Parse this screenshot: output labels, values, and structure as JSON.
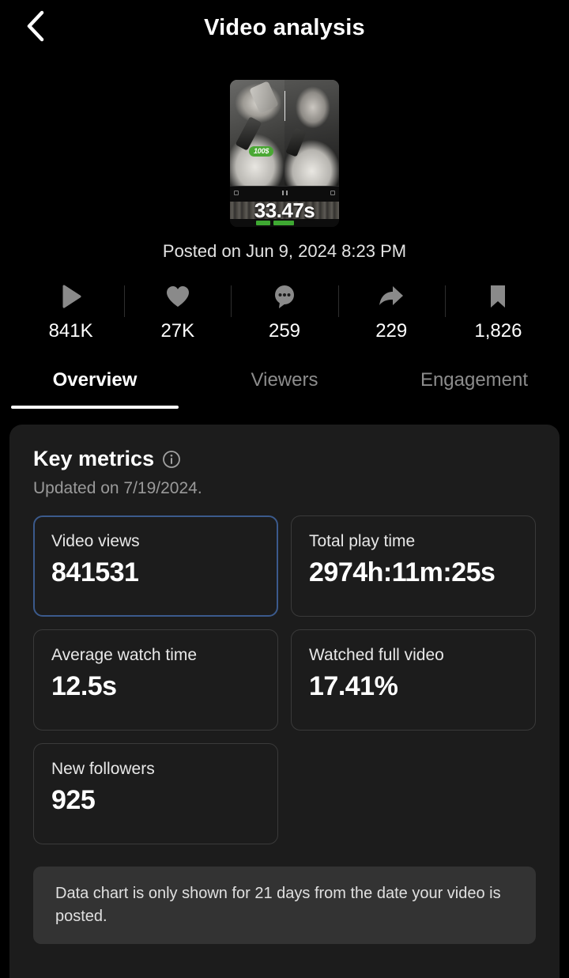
{
  "header": {
    "back_icon": "chevron-left-icon",
    "title": "Video analysis"
  },
  "video": {
    "duration": "33.47s",
    "badge": "100$",
    "posted": "Posted on Jun 9, 2024 8:23 PM"
  },
  "stats": [
    {
      "icon": "play-icon",
      "value": "841K"
    },
    {
      "icon": "heart-icon",
      "value": "27K"
    },
    {
      "icon": "comment-icon",
      "value": "259"
    },
    {
      "icon": "share-icon",
      "value": "229"
    },
    {
      "icon": "bookmark-icon",
      "value": "1,826"
    }
  ],
  "tabs": [
    {
      "label": "Overview",
      "active": true
    },
    {
      "label": "Viewers",
      "active": false
    },
    {
      "label": "Engagement",
      "active": false
    }
  ],
  "key_metrics": {
    "title": "Key metrics",
    "info_icon": "info-circle-icon",
    "updated": "Updated on 7/19/2024.",
    "cards": [
      {
        "label": "Video views",
        "value": "841531",
        "selected": true
      },
      {
        "label": "Total play time",
        "value": "2974h:11m:25s",
        "selected": false
      },
      {
        "label": "Average watch time",
        "value": "12.5s",
        "selected": false
      },
      {
        "label": "Watched full video",
        "value": "17.41%",
        "selected": false
      },
      {
        "label": "New followers",
        "value": "925",
        "selected": false
      }
    ]
  },
  "note": "Data chart is only shown for 21 days from the date your video is posted.",
  "colors": {
    "background": "#000000",
    "panel": "#1c1c1c",
    "card_border": "#3a3a3a",
    "selected_border": "#3b5a8c",
    "note_background": "#333333",
    "accent_green": "#4aa834",
    "muted_text": "#9a9a9a"
  }
}
